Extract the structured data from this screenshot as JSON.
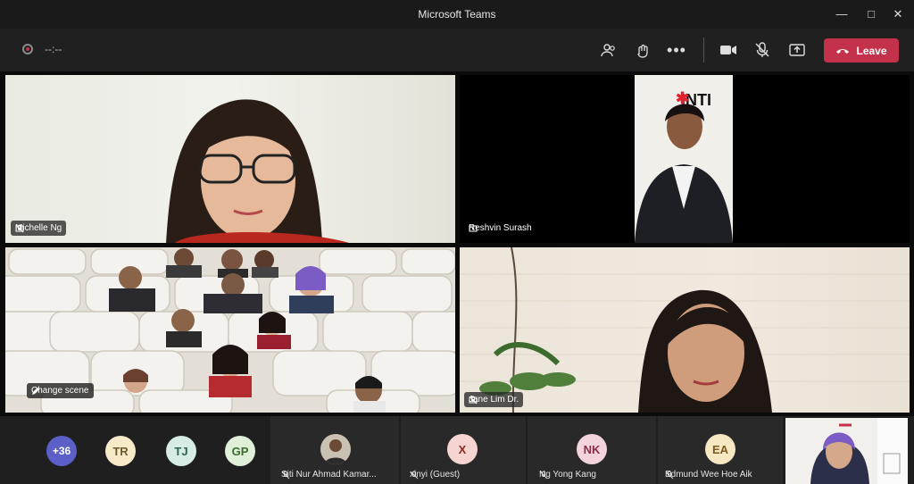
{
  "window": {
    "title": "Microsoft Teams"
  },
  "toolbar": {
    "timer": "--:--",
    "leave_label": "Leave"
  },
  "tiles": {
    "michelle": {
      "name": "Michelle Ng"
    },
    "reshvin": {
      "name": "Reshvin Surash",
      "backdrop_text": "INTI"
    },
    "scene": {
      "change_scene": "Change scene"
    },
    "jane": {
      "name": "Jane Lim Dr."
    }
  },
  "overflow": {
    "count": "+36",
    "avatars": [
      "TR",
      "TJ",
      "GP"
    ]
  },
  "participants": [
    {
      "name": "Siti Nur Ahmad Kamar...",
      "initials": ""
    },
    {
      "name": "xinyi (Guest)",
      "initials": "X"
    },
    {
      "name": "Ng Yong Kang",
      "initials": "NK"
    },
    {
      "name": "Edmund Wee Hoe Aik",
      "initials": "EA"
    }
  ],
  "colors": {
    "accent": "#6264a7",
    "leave": "#c4314b",
    "background": "#0b0b0b"
  }
}
